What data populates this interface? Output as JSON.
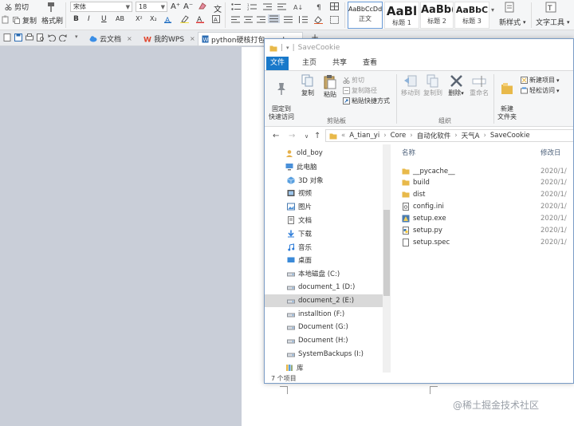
{
  "wps": {
    "ribbon": {
      "cut": "剪切",
      "copy": "复制",
      "format_painter": "格式刷",
      "font": "宋体",
      "size": "18",
      "bold": "B",
      "italic": "I",
      "underline": "U",
      "strike": "AB",
      "superscript": "X²",
      "subscript": "X₂",
      "styles": [
        {
          "sample": "AaBbCcDd",
          "name": "正文"
        },
        {
          "sample": "AaBl",
          "name": "标题 1"
        },
        {
          "sample": "AaBb(",
          "name": "标题 2"
        },
        {
          "sample": "AaBbC",
          "name": "标题 3"
        }
      ],
      "new_style": "新样式",
      "text_tools": "文字工具"
    },
    "tabs": [
      {
        "label": "云文档"
      },
      {
        "label": "我的WPS"
      },
      {
        "label": "python硬核打包exe.doc"
      }
    ],
    "tab_add": "+"
  },
  "explorer": {
    "title": "SaveCookie",
    "menu": [
      "文件",
      "主页",
      "共享",
      "查看"
    ],
    "ribbon": {
      "pin": "固定到\n快速访问",
      "copy": "复制",
      "paste": "粘贴",
      "cut": "剪切",
      "copy_path": "复制路径",
      "paste_shortcut": "粘贴快捷方式",
      "clipboard_group": "剪贴板",
      "move_to": "移动到",
      "copy_to": "复制到",
      "delete": "删除",
      "rename": "重命名",
      "organize_group": "组织",
      "new_folder": "新建\n文件夹",
      "new_item": "新建项目",
      "easy_access": "轻松访问"
    },
    "path": [
      "A_tian_yi",
      "Core",
      "自动化软件",
      "天气A",
      "SaveCookie"
    ],
    "nav": [
      {
        "label": "old_boy",
        "icon": "user-icon",
        "indent": 1
      },
      {
        "label": "此电脑",
        "icon": "computer-icon",
        "indent": 1
      },
      {
        "label": "3D 对象",
        "icon": "cube-icon",
        "indent": 2
      },
      {
        "label": "视频",
        "icon": "video-icon",
        "indent": 2
      },
      {
        "label": "图片",
        "icon": "picture-icon",
        "indent": 2
      },
      {
        "label": "文档",
        "icon": "document-icon",
        "indent": 2
      },
      {
        "label": "下载",
        "icon": "download-icon",
        "indent": 2
      },
      {
        "label": "音乐",
        "icon": "music-icon",
        "indent": 2
      },
      {
        "label": "桌面",
        "icon": "desktop-icon",
        "indent": 2
      },
      {
        "label": "本地磁盘 (C:)",
        "icon": "drive-icon",
        "indent": 2
      },
      {
        "label": "document_1 (D:)",
        "icon": "drive-icon",
        "indent": 2
      },
      {
        "label": "document_2 (E:)",
        "icon": "drive-icon",
        "indent": 2,
        "selected": true
      },
      {
        "label": "installtion (F:)",
        "icon": "drive-icon",
        "indent": 2
      },
      {
        "label": "Document (G:)",
        "icon": "drive-icon",
        "indent": 2
      },
      {
        "label": "Document (H:)",
        "icon": "drive-icon",
        "indent": 2
      },
      {
        "label": "SystemBackups (I:)",
        "icon": "drive-icon",
        "indent": 2
      },
      {
        "label": "库",
        "icon": "library-icon",
        "indent": 1
      }
    ],
    "columns": {
      "name": "名称",
      "modified": "修改日"
    },
    "files": [
      {
        "name": "__pycache__",
        "icon": "folder-icon",
        "date": "2020/1/"
      },
      {
        "name": "build",
        "icon": "folder-icon",
        "date": "2020/1/"
      },
      {
        "name": "dist",
        "icon": "folder-icon",
        "date": "2020/1/"
      },
      {
        "name": "config.ini",
        "icon": "config-file-icon",
        "date": "2020/1/"
      },
      {
        "name": "setup.exe",
        "icon": "exe-file-icon",
        "date": "2020/1/"
      },
      {
        "name": "setup.py",
        "icon": "python-file-icon",
        "date": "2020/1/"
      },
      {
        "name": "setup.spec",
        "icon": "file-icon",
        "date": "2020/1/"
      }
    ],
    "status": "7 个项目"
  },
  "watermark": "@稀土掘金技术社区",
  "colors": {
    "accent": "#1979ca",
    "folder": "#e8b94a",
    "selected": "#d9d9d9"
  }
}
